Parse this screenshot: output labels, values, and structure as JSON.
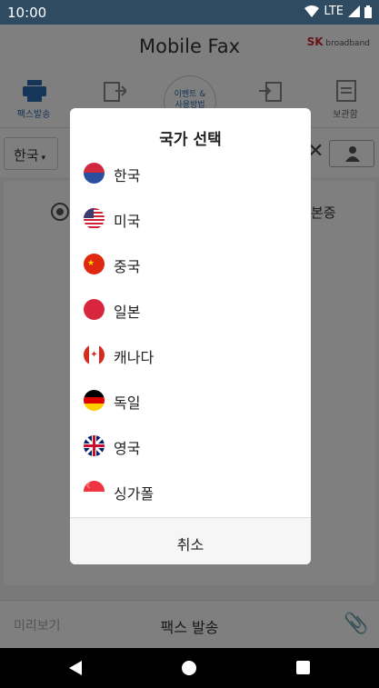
{
  "status_bar": {
    "time": "10:00",
    "network": "LTE"
  },
  "app_bar": {
    "title": "Mobile Fax",
    "logo_brand": "SK",
    "logo_sub": "broadband"
  },
  "tabs": [
    {
      "label": "팩스발송",
      "active": true
    },
    {
      "label": "",
      "active": false
    },
    {
      "label": "",
      "active": false
    },
    {
      "label": "보관함",
      "active": false
    }
  ],
  "event_tab": {
    "line1": "이벤트 &",
    "line2": "사용방법"
  },
  "recipient": {
    "country": "한국"
  },
  "auth_text": "본증",
  "bottom_bar": {
    "preview": "미리보기",
    "send": "팩스 발송"
  },
  "dialog": {
    "title": "국가 선택",
    "countries": [
      {
        "name": "한국",
        "flag": "korea-flag-icon"
      },
      {
        "name": "미국",
        "flag": "usa-flag-icon"
      },
      {
        "name": "중국",
        "flag": "china-flag-icon"
      },
      {
        "name": "일본",
        "flag": "japan-flag-icon"
      },
      {
        "name": "캐나다",
        "flag": "canada-flag-icon"
      },
      {
        "name": "독일",
        "flag": "germany-flag-icon"
      },
      {
        "name": "영국",
        "flag": "uk-flag-icon"
      },
      {
        "name": "싱가폴",
        "flag": "singapore-flag-icon"
      }
    ],
    "cancel": "취소"
  },
  "colors": {
    "status_bar": "#2e4b61",
    "accent": "#2b6cb0",
    "scrim": "rgba(0,0,0,0.5)"
  }
}
